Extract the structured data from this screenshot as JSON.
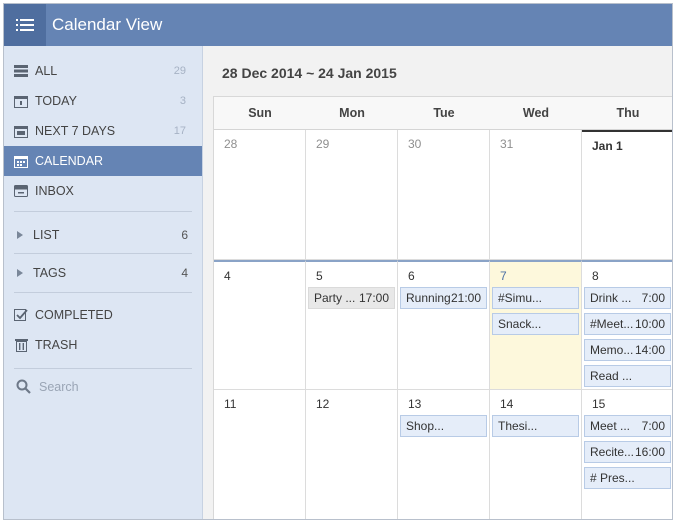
{
  "app": {
    "title": "Calendar View"
  },
  "sidebar": {
    "items": [
      {
        "label": "ALL",
        "count": "29",
        "icon": "stack-icon"
      },
      {
        "label": "TODAY",
        "count": "3",
        "icon": "today-icon"
      },
      {
        "label": "NEXT 7 DAYS",
        "count": "17",
        "icon": "week-icon"
      },
      {
        "label": "CALENDAR",
        "count": "",
        "icon": "calendar-icon"
      },
      {
        "label": "INBOX",
        "count": "",
        "icon": "inbox-icon"
      }
    ],
    "groups": [
      {
        "label": "LIST",
        "count": "6"
      },
      {
        "label": "TAGS",
        "count": "4"
      }
    ],
    "bottom": [
      {
        "label": "COMPLETED",
        "icon": "checkbox-icon"
      },
      {
        "label": "TRASH",
        "icon": "trash-icon"
      }
    ],
    "search_placeholder": "Search"
  },
  "calendar": {
    "range": "28 Dec 2014 ~ 24 Jan 2015",
    "weekdays": [
      "Sun",
      "Mon",
      "Tue",
      "Wed",
      "Thu"
    ],
    "weeks": [
      [
        "28",
        "29",
        "30",
        "31",
        "Jan 1"
      ],
      [
        "4",
        "5",
        "6",
        "7",
        "8"
      ],
      [
        "11",
        "12",
        "13",
        "14",
        "15"
      ]
    ],
    "events": {
      "mon5": {
        "name": "Party ...",
        "time": "17:00"
      },
      "tue6": {
        "name": "Running",
        "time": "21:00"
      },
      "wed7": [
        {
          "name": "#Simu..."
        },
        {
          "name": "Snack..."
        }
      ],
      "thu8": [
        {
          "name": "Drink ...",
          "time": "7:00"
        },
        {
          "name": "#Meet...",
          "time": "10:00"
        },
        {
          "name": "Memo...",
          "time": "14:00"
        },
        {
          "name": "Read ..."
        }
      ],
      "tue13": {
        "name": "Shop..."
      },
      "wed14": {
        "name": "Thesi..."
      },
      "thu15": [
        {
          "name": "Meet ...",
          "time": "7:00"
        },
        {
          "name": "Recite...",
          "time": "16:00"
        },
        {
          "name": "# Pres..."
        }
      ]
    }
  },
  "colors": {
    "accent": "#6584b4",
    "today": "#fdf8dc",
    "sidebar": "#dde6f3"
  }
}
